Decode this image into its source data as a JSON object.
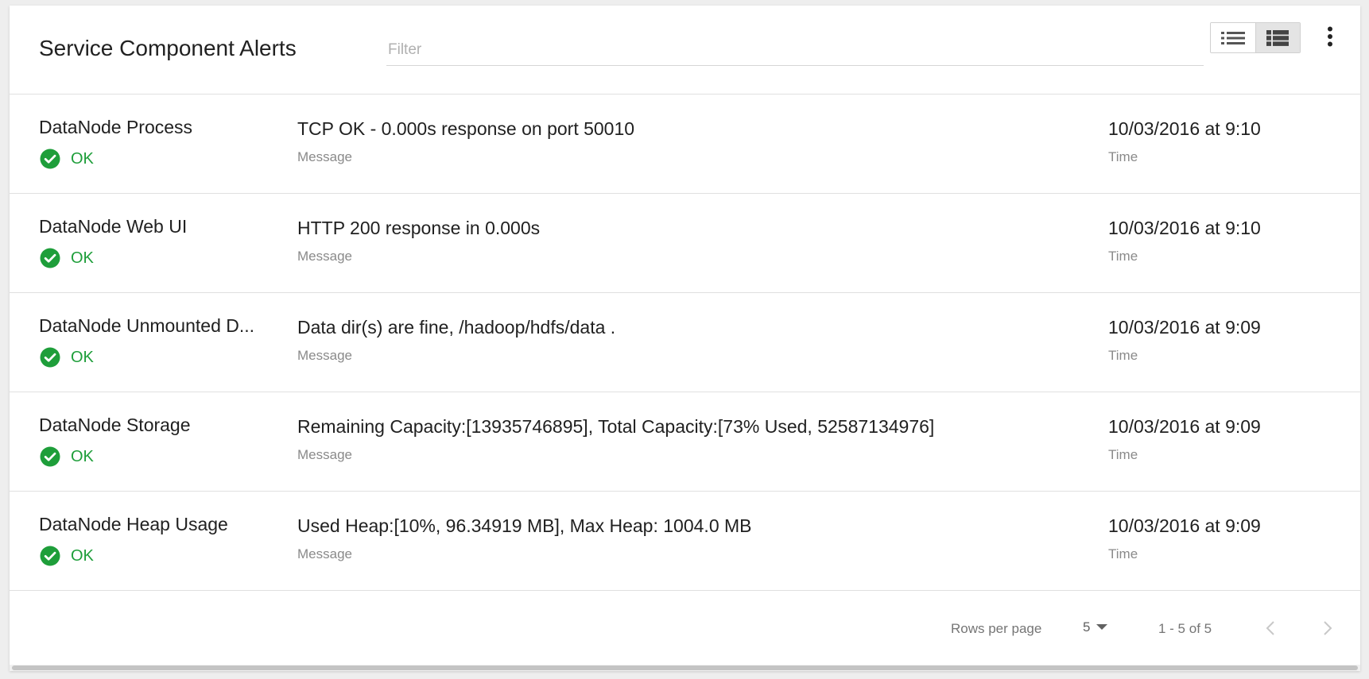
{
  "header": {
    "title": "Service Component Alerts",
    "filter_placeholder": "Filter",
    "view_toggle": [
      "list-icon",
      "detailed-list-icon"
    ],
    "more_icon": "more-vert-icon"
  },
  "alerts": [
    {
      "name": "DataNode Process",
      "status": "OK",
      "message": "TCP OK - 0.000s response on port 50010",
      "message_label": "Message",
      "time": "10/03/2016 at 9:10",
      "time_label": "Time"
    },
    {
      "name": "DataNode Web UI",
      "status": "OK",
      "message": "HTTP 200 response in 0.000s",
      "message_label": "Message",
      "time": "10/03/2016 at 9:10",
      "time_label": "Time"
    },
    {
      "name": "DataNode Unmounted D...",
      "status": "OK",
      "message": "Data dir(s) are fine, /hadoop/hdfs/data .",
      "message_label": "Message",
      "time": "10/03/2016 at 9:09",
      "time_label": "Time"
    },
    {
      "name": "DataNode Storage",
      "status": "OK",
      "message": "Remaining Capacity:[13935746895], Total Capacity:[73% Used, 52587134976]",
      "message_label": "Message",
      "time": "10/03/2016 at 9:09",
      "time_label": "Time"
    },
    {
      "name": "DataNode Heap Usage",
      "status": "OK",
      "message": "Used Heap:[10%, 96.34919 MB], Max Heap: 1004.0 MB",
      "message_label": "Message",
      "time": "10/03/2016 at 9:09",
      "time_label": "Time"
    }
  ],
  "footer": {
    "rows_per_page_label": "Rows per page",
    "rows_per_page_value": "5",
    "range": "1 - 5 of 5"
  },
  "colors": {
    "ok_green": "#1e9e3a",
    "secondary_text": "#8a8a8a"
  }
}
